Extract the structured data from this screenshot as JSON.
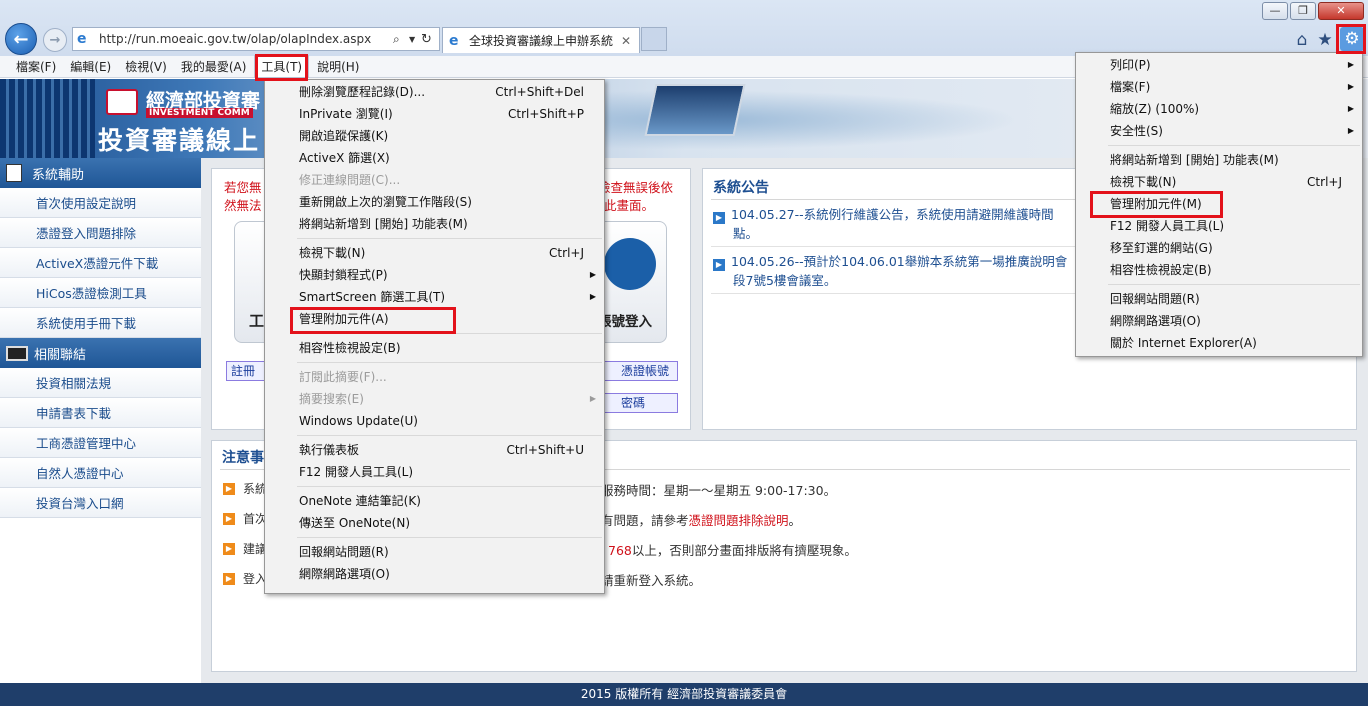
{
  "browser": {
    "url": "http://run.moeaic.gov.tw/olap/olapIndex.aspx",
    "tab_title": "全球投資審議線上申辦系統",
    "window_controls": {
      "minimize": "—",
      "maximize": "❐",
      "close": "✕"
    }
  },
  "menubar": {
    "items": [
      "檔案(F)",
      "編輯(E)",
      "檢視(V)",
      "我的最愛(A)",
      "工具(T)",
      "說明(H)"
    ]
  },
  "banner": {
    "org_name": "經濟部投資審",
    "org_en": "INVESTMENT COMM",
    "subtitle": "投資審議線上"
  },
  "sidebar": {
    "section1": "系統輔助",
    "items1": [
      "首次使用設定說明",
      "憑證登入問題排除",
      "ActiveX憑證元件下載",
      "HiCos憑證檢測工具",
      "系統使用手冊下載"
    ],
    "section2": "相關聯結",
    "items2": [
      "投資相關法規",
      "申請書表下載",
      "工商憑證管理中心",
      "自然人憑證中心",
      "投資台灣入口網"
    ]
  },
  "login_panel": {
    "warn_left1": "若您無",
    "warn_left2": "然無法",
    "warn_right1": "檢查無誤後依",
    "warn_right2": "此畫面。",
    "card_left_char": "工",
    "card_right_label": "帳號登入",
    "link_left": "註冊",
    "link_right1": "憑證帳號",
    "link_right2": "密碼"
  },
  "announcements": {
    "title": "系統公告",
    "items": [
      {
        "line1": "104.05.27--系統例行維護公告，系統使用請避開維護時間",
        "line2": "點。"
      },
      {
        "line1": "104.05.26--預計於104.06.01舉辦本系統第一場推廣說明會",
        "line2": "段7號5樓會議室。"
      }
    ]
  },
  "notes": {
    "title": "注意事",
    "items": [
      {
        "left": "系統",
        "right": "服務時間：星期一～星期五 9:00-17:30。",
        "link": ""
      },
      {
        "left": "首次",
        "right": "有問題，請參考",
        "link": "憑證問題排除說明",
        "tail": "。"
      },
      {
        "left": "建議",
        "right_red": "768",
        "right": "以上，否則部分畫面排版將有擠壓現象。"
      },
      {
        "left": "登入",
        "right": "請重新登入系統。"
      }
    ]
  },
  "tools_menu": {
    "items": [
      {
        "label": "刪除瀏覽歷程記錄(D)...",
        "shortcut": "Ctrl+Shift+Del"
      },
      {
        "label": "InPrivate 瀏覽(I)",
        "shortcut": "Ctrl+Shift+P"
      },
      {
        "label": "開啟追蹤保護(K)"
      },
      {
        "label": "ActiveX 篩選(X)"
      },
      {
        "label": "修正連線問題(C)...",
        "disabled": true
      },
      {
        "label": "重新開啟上次的瀏覽工作階段(S)"
      },
      {
        "label": "將網站新增到 [開始] 功能表(M)"
      },
      {
        "label": "檢視下載(N)",
        "shortcut": "Ctrl+J"
      },
      {
        "label": "快顯封鎖程式(P)",
        "submenu": true
      },
      {
        "label": "SmartScreen 篩選工具(T)",
        "submenu": true
      },
      {
        "label": "管理附加元件(A)"
      },
      {
        "label": "相容性檢視設定(B)"
      },
      {
        "label": "訂閱此摘要(F)...",
        "disabled": true
      },
      {
        "label": "摘要搜索(E)",
        "disabled": true,
        "submenu": true
      },
      {
        "label": "Windows Update(U)"
      },
      {
        "label": "執行儀表板",
        "shortcut": "Ctrl+Shift+U"
      },
      {
        "label": "F12 開發人員工具(L)"
      },
      {
        "label": "OneNote 連結筆記(K)"
      },
      {
        "label": "傳送至 OneNote(N)"
      },
      {
        "label": "回報網站問題(R)"
      },
      {
        "label": "網際網路選項(O)"
      }
    ]
  },
  "gear_menu": {
    "items": [
      {
        "label": "列印(P)",
        "submenu": true
      },
      {
        "label": "檔案(F)",
        "submenu": true
      },
      {
        "label": "縮放(Z) (100%)",
        "submenu": true
      },
      {
        "label": "安全性(S)",
        "submenu": true
      },
      {
        "label": "將網站新增到 [開始] 功能表(M)"
      },
      {
        "label": "檢視下載(N)",
        "shortcut": "Ctrl+J"
      },
      {
        "label": "管理附加元件(M)"
      },
      {
        "label": "F12 開發人員工具(L)"
      },
      {
        "label": "移至釘選的網站(G)"
      },
      {
        "label": "相容性檢視設定(B)"
      },
      {
        "label": "回報網站問題(R)"
      },
      {
        "label": "網際網路選項(O)"
      },
      {
        "label": "關於 Internet Explorer(A)"
      }
    ]
  },
  "footer": {
    "text": "2015 版權所有 經濟部投資審議委員會"
  },
  "colors": {
    "accent": "#1f5696",
    "highlight": "#e3121b",
    "footer": "#1f3e6a"
  }
}
